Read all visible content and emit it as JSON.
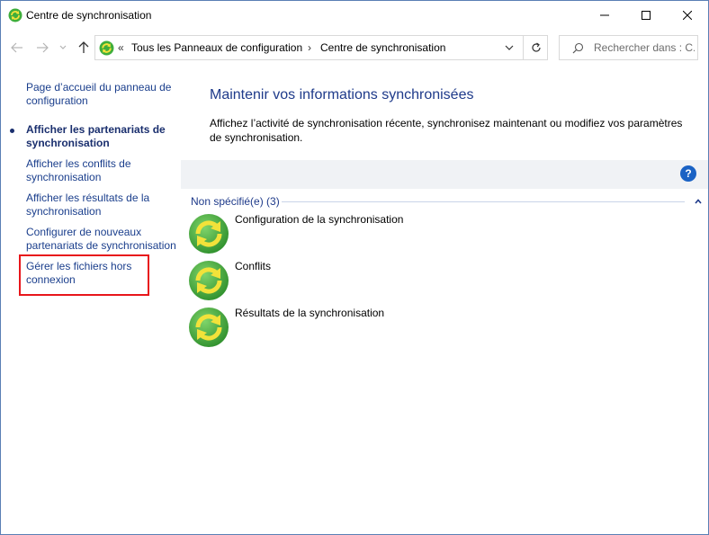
{
  "window": {
    "title": "Centre de synchronisation"
  },
  "address": {
    "overflow_chevron": "«",
    "crumbs": [
      "Tous les Panneaux de configuration",
      "Centre de synchronisation"
    ],
    "separator": "›"
  },
  "search": {
    "placeholder": "Rechercher dans : C..."
  },
  "sidebar": {
    "items": [
      {
        "label": "Page d’accueil du panneau de configuration"
      },
      {
        "label": "Afficher les partenariats de synchronisation",
        "active": true
      },
      {
        "label": "Afficher les conflits de synchronisation"
      },
      {
        "label": "Afficher les résultats de la synchronisation"
      },
      {
        "label": "Configurer de nouveaux partenariats de synchronisation"
      },
      {
        "label": "Gérer les fichiers hors connexion",
        "highlighted": true
      }
    ]
  },
  "main": {
    "title": "Maintenir vos informations synchronisées",
    "description": "Affichez l’activité de synchronisation récente, synchronisez maintenant ou modifiez vos paramètres de synchronisation.",
    "help_label": "?",
    "group": {
      "header": "Non spécifié(e) (3)",
      "items": [
        {
          "label": "Configuration de la synchronisation",
          "icon": "sync-icon"
        },
        {
          "label": "Conflits",
          "icon": "sync-icon"
        },
        {
          "label": "Résultats de la synchronisation",
          "icon": "sync-icon"
        }
      ]
    }
  },
  "colors": {
    "link": "#1a3e8c",
    "title": "#1e3a8a",
    "highlight": "#e8161b",
    "sync_green": "#3fae3b",
    "sync_arrow": "#f2e23a"
  }
}
